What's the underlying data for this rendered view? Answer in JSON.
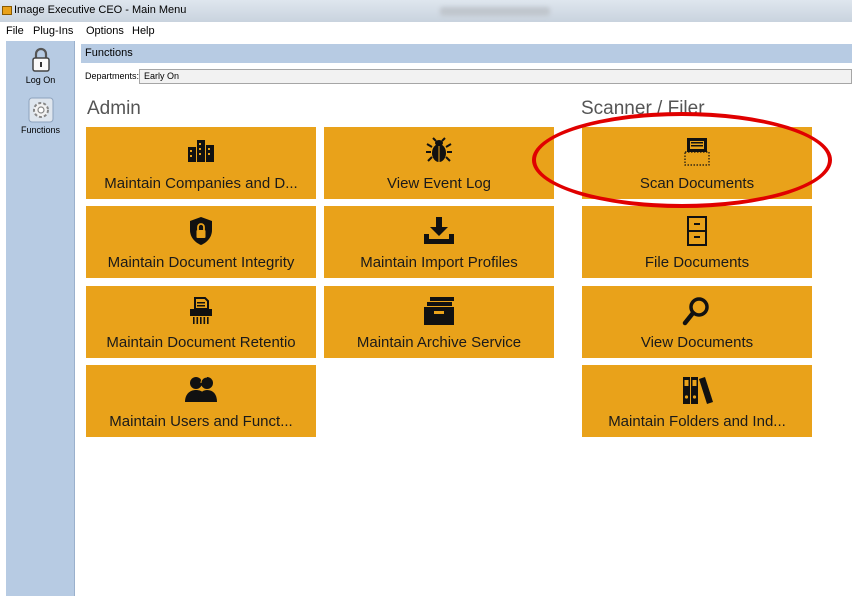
{
  "window": {
    "title": "Image Executive CEO - Main Menu"
  },
  "menu": [
    "File",
    "Plug-Ins",
    "Options",
    "Help"
  ],
  "sidebar": {
    "items": [
      {
        "label": "Log On"
      },
      {
        "label": "Functions"
      }
    ]
  },
  "functions_header": "Functions",
  "departments": {
    "label": "Departments:",
    "value": "Early On"
  },
  "sections": {
    "admin": {
      "title": "Admin",
      "col1": [
        {
          "label": "Maintain Companies and D...",
          "icon": "buildings-icon"
        },
        {
          "label": "Maintain Document Integrity",
          "icon": "shield-lock-icon"
        },
        {
          "label": "Maintain Document Retentio",
          "icon": "shredder-icon"
        },
        {
          "label": "Maintain Users and Funct...",
          "icon": "users-icon"
        }
      ],
      "col2": [
        {
          "label": "View Event Log",
          "icon": "bug-icon"
        },
        {
          "label": "Maintain Import Profiles",
          "icon": "download-tray-icon"
        },
        {
          "label": "Maintain Archive Service",
          "icon": "archive-drawer-icon"
        }
      ]
    },
    "scanner": {
      "title": "Scanner / Filer",
      "items": [
        {
          "label": "Scan Documents",
          "icon": "scanner-icon"
        },
        {
          "label": "File Documents",
          "icon": "file-cabinet-icon"
        },
        {
          "label": "View Documents",
          "icon": "magnifier-icon"
        },
        {
          "label": "Maintain Folders and Ind...",
          "icon": "binders-icon"
        }
      ]
    }
  },
  "colors": {
    "tile": "#e9a21a",
    "sidebar": "#b7cbe3",
    "highlight": "#e00000"
  }
}
